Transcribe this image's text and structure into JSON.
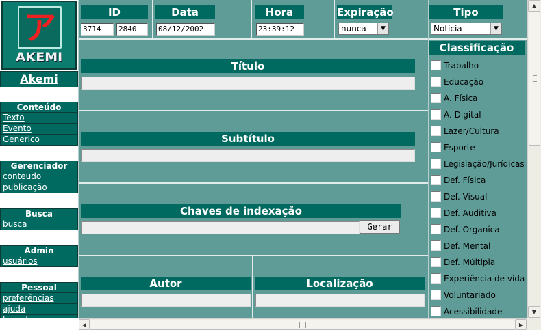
{
  "sidebar": {
    "logo_glyph": "ア",
    "logo_word": "AKEMI",
    "brand": "Akemi",
    "sections": [
      {
        "title": "Conteúdo",
        "items": [
          "Texto",
          "Evento",
          "Generico"
        ]
      },
      {
        "title": "Gerenciador",
        "items": [
          "conteudo",
          "publicação"
        ]
      },
      {
        "title": "Busca",
        "items": [
          "busca"
        ]
      },
      {
        "title": "Admin",
        "items": [
          "usuários"
        ]
      },
      {
        "title": "Pessoal",
        "items": [
          "preferências",
          "ajuda",
          "logout"
        ]
      }
    ]
  },
  "top": {
    "id_label": "ID",
    "id_value_1": "3714",
    "id_value_2": "2840",
    "date_label": "Data",
    "date_value": "08/12/2002",
    "time_label": "Hora",
    "time_value": "23:39:12",
    "expiration_label": "Expiração",
    "expiration_value": "nunca",
    "type_label": "Tipo",
    "type_value": "Notícia"
  },
  "form": {
    "title_label": "Título",
    "title_value": "",
    "subtitle_label": "Subtítulo",
    "subtitle_value": "",
    "keys_label": "Chaves de indexação",
    "keys_value": "",
    "generate_button": "Gerar",
    "author_label": "Autor",
    "author_value": "",
    "location_label": "Localização",
    "location_value": ""
  },
  "classification": {
    "title": "Classificação",
    "items": [
      "Trabalho",
      "Educação",
      "A. Física",
      "A. Digital",
      "Lazer/Cultura",
      "Esporte",
      "Legislação/Jurídicas",
      "Def. Física",
      "Def. Visual",
      "Def. Auditiva",
      "Def. Organica",
      "Def. Mental",
      "Def. Múltipla",
      "Experiência de vida",
      "Voluntariado",
      "Acessibilidade"
    ]
  },
  "colors": {
    "header": "#006a60",
    "panel": "#5f9c97",
    "logo_accent": "#ef2020"
  },
  "icons": {
    "dropdown": "chevron-down-icon",
    "scroll_up": "arrow-up-icon",
    "scroll_down": "arrow-down-icon",
    "scroll_left": "arrow-left-icon",
    "scroll_right": "arrow-right-icon"
  }
}
